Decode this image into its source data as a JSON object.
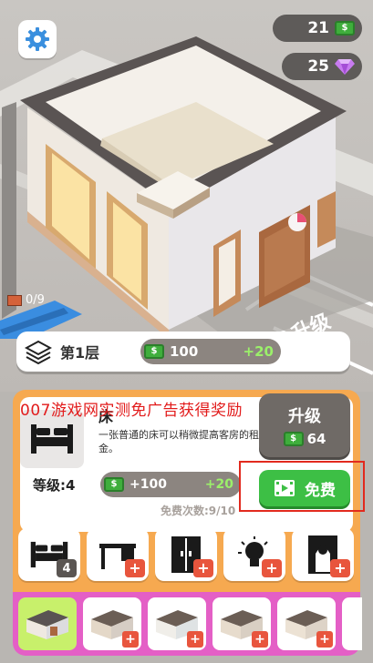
{
  "hud": {
    "cash": "21",
    "gems": "25"
  },
  "scene": {
    "progress": "0/9",
    "ground_label": "升级"
  },
  "floor_bar": {
    "label": "第1层",
    "income": "100",
    "income_plus": "+20"
  },
  "promo_text": "007游戏网实测免广告获得奖励",
  "item": {
    "name": "床",
    "description": "一张普通的床可以稍微提高客房的租金。",
    "level": "等级:4",
    "income": "+100",
    "income_plus": "+20",
    "free_count": "免费次数:9/10"
  },
  "upgrade_button": {
    "label": "升级",
    "cost": "64"
  },
  "free_button": {
    "label": "免费"
  },
  "categories": [
    {
      "icon": "bed-icon",
      "badge": "4"
    },
    {
      "icon": "desk-icon",
      "badge": "+"
    },
    {
      "icon": "wardrobe-icon",
      "badge": "+"
    },
    {
      "icon": "lamp-icon",
      "badge": "+"
    },
    {
      "icon": "mirror-icon",
      "badge": "+"
    }
  ],
  "colors": {
    "panel": "#f6a950",
    "green": "#3dbf45",
    "accent_pink": "#e45fc6",
    "promo_red": "#e21b1b"
  }
}
